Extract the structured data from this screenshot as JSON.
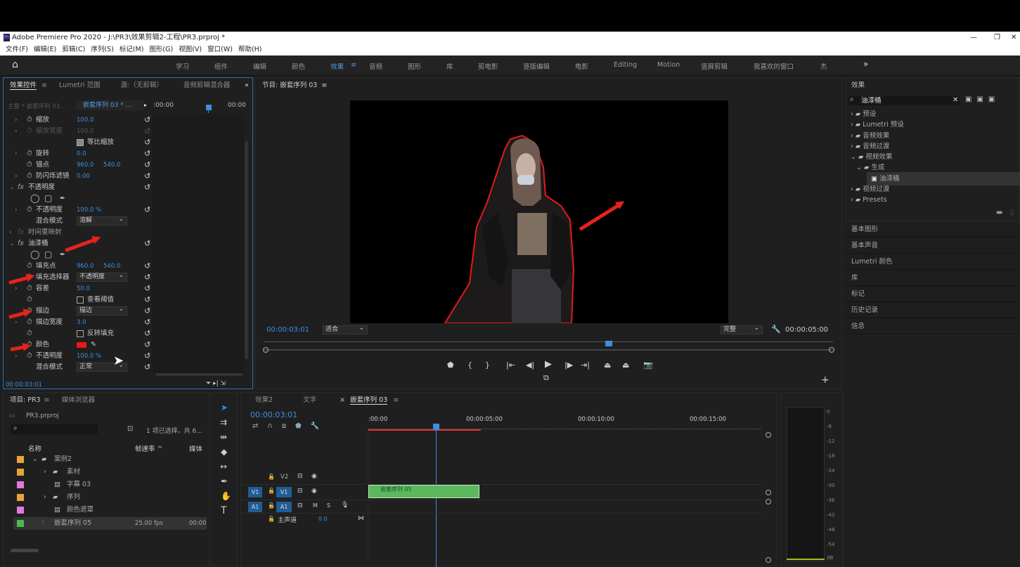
{
  "titlebar": {
    "title": "Adobe Premiere Pro 2020 - J:\\PR3\\效果剪辑2-工程\\PR3.prproj *",
    "app_icon": "Pr"
  },
  "menu": [
    "文件(F)",
    "编辑(E)",
    "剪辑(C)",
    "序列(S)",
    "标记(M)",
    "图形(G)",
    "视图(V)",
    "窗口(W)",
    "帮助(H)"
  ],
  "workspaces": [
    "学习",
    "组件",
    "编辑",
    "颜色",
    "效果",
    "音频",
    "图形",
    "库",
    "剪电影",
    "竖版编辑",
    "电影",
    "Editing",
    "Motion",
    "竖屏剪辑",
    "我喜欢的窗口",
    "杰"
  ],
  "active_workspace": "效果",
  "effect_controls": {
    "tabs": [
      "效果控件",
      "Lumetri 范围",
      "源:（无剪辑）",
      "音频剪辑混合器"
    ],
    "master": "主要 * 嵌套序列 03...",
    "sequence": "嵌套序列 03 * ...",
    "time_start": ":00:00",
    "time_end": "00:00",
    "rows": [
      {
        "label": "缩放",
        "value": "100.0"
      },
      {
        "label": "缩放宽度",
        "value": "100.0"
      },
      {
        "label": "等比缩放",
        "value": ""
      },
      {
        "label": "旋转",
        "value": "0.0"
      },
      {
        "label": "锚点",
        "value": "960.0",
        "value2": "540.0"
      },
      {
        "label": "防闪烁滤镜",
        "value": "0.00"
      },
      {
        "label": "不透明度",
        "value": ""
      },
      {
        "label": "不透明度",
        "value": "100.0 %"
      },
      {
        "label": "混合模式",
        "value": "溶解"
      },
      {
        "label": "时间重映射",
        "value": ""
      },
      {
        "label": "油漆桶",
        "value": ""
      },
      {
        "label": "填充点",
        "value": "960.0",
        "value2": "540.0"
      },
      {
        "label": "填充选择器",
        "value": "不透明度"
      },
      {
        "label": "容差",
        "value": "50.0"
      },
      {
        "label": "查看阈值",
        "value": ""
      },
      {
        "label": "描边",
        "value": "描边"
      },
      {
        "label": "描边宽度",
        "value": "3.0"
      },
      {
        "label": "反转填充",
        "value": ""
      },
      {
        "label": "颜色",
        "value": ""
      },
      {
        "label": "不透明度",
        "value": "100.0 %"
      },
      {
        "label": "混合模式",
        "value": "正常"
      }
    ],
    "fx_label": "fx",
    "timecode": "00:00:03:01",
    "fill_color": "#e51a1a"
  },
  "program": {
    "tab": "节目: 嵌套序列 03",
    "timecode": "00:00:03:01",
    "fit": "适合",
    "quality": "完整",
    "duration": "00:00:05:00"
  },
  "effects_panel": {
    "tab": "效果",
    "search": "油漆桶",
    "tree": [
      "预设",
      "Lumetri 预设",
      "音频效果",
      "音频过渡",
      "视频效果",
      "生成",
      "油漆桶",
      "视频过渡",
      "Presets"
    ],
    "sections": [
      "基本图形",
      "基本声音",
      "Lumetri 颜色",
      "库",
      "标记",
      "历史记录",
      "信息"
    ]
  },
  "project": {
    "tabs": [
      "项目: PR3",
      "媒体浏览器"
    ],
    "file": "PR3.prproj",
    "status": "1 项已选择，共 6...",
    "columns": [
      "名称",
      "帧速率 ^",
      "媒体"
    ],
    "items": [
      {
        "name": "案例2",
        "color": "#e8a33a",
        "fps": ""
      },
      {
        "name": "素材",
        "color": "#e8a33a",
        "fps": ""
      },
      {
        "name": "字幕 03",
        "color": "#e27ad8",
        "fps": ""
      },
      {
        "name": "序列",
        "color": "#e8a33a",
        "fps": ""
      },
      {
        "name": "颜色遮罩",
        "color": "#e27ad8",
        "fps": ""
      },
      {
        "name": "嵌套序列 05",
        "color": "#4cb84c",
        "fps": "25.00 fps",
        "media": "00:00"
      }
    ]
  },
  "timeline": {
    "tabs": [
      "效果2",
      "文字",
      "嵌套序列 03"
    ],
    "timecode": "00:00:03:01",
    "ruler": [
      ":00:00",
      "00:00:05:00",
      "00:00:10:00",
      "00:00:15:00"
    ],
    "tracks": [
      "V2",
      "V1",
      "A1"
    ],
    "master": "主声道",
    "master_val": "0.0",
    "clip": "嵌套序列 05",
    "track_buttons": [
      "M",
      "S"
    ]
  },
  "meter": {
    "scale": [
      "0",
      "-6",
      "-12",
      "-18",
      "-24",
      "-30",
      "-36",
      "-42",
      "-48",
      "-54",
      "dB"
    ]
  }
}
